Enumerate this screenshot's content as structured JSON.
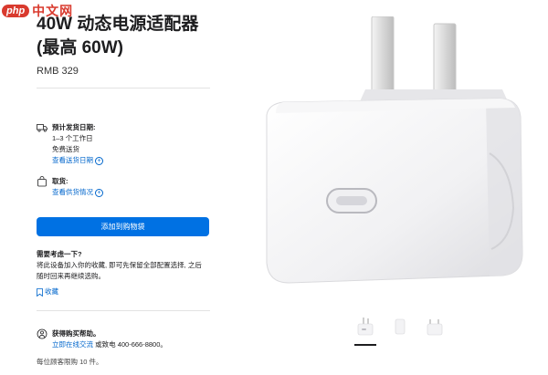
{
  "watermark": {
    "brand_short": "php",
    "brand_cn": "中文网"
  },
  "product": {
    "title_line1": "40W 动态电源适配器",
    "title_line2": "(最高 60W)",
    "price": "RMB 329"
  },
  "delivery": {
    "heading": "预计发货日期:",
    "days": "1–3 个工作日",
    "shipping": "免费送货",
    "link": "查看送货日期"
  },
  "pickup": {
    "heading": "取货:",
    "link": "查看供货情况"
  },
  "cart": {
    "button_label": "添加到购物袋"
  },
  "save_later": {
    "heading": "需要考虑一下?",
    "body_line1": "将此设备加入你的收藏, 即可先保留全部配置选择, 之后",
    "body_line2": "随时回来再继续选购。",
    "link": "收藏"
  },
  "help": {
    "heading": "获得购买帮助。",
    "chat_link": "立即在线交流",
    "phone_prefix": "或致电",
    "phone": "400-666-8800。"
  },
  "limit": {
    "text": "每位顾客限购 10 件。"
  },
  "gallery": {
    "selected_index": 0,
    "thumbnail_count": 3
  },
  "colors": {
    "accent": "#0071e3",
    "link": "#0066cc",
    "watermark": "#d93a2e"
  }
}
